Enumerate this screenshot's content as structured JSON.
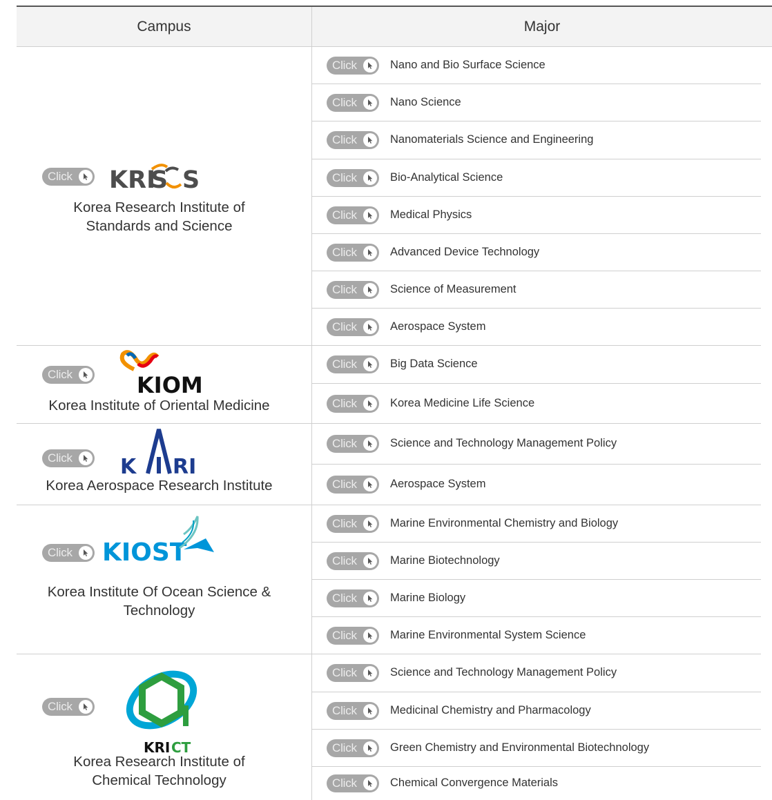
{
  "header": {
    "campus": "Campus",
    "major": "Major"
  },
  "click_label": "Click",
  "colors": {
    "button": "#a7a7a7",
    "kriss": "#4d4d4d",
    "kriss_accent": "#f29100",
    "kiom_blue": "#0068b7",
    "kari_blue": "#1d3c8f",
    "kiost_blue": "#0095d9",
    "krict_green": "#2e9e3f"
  },
  "campuses": [
    {
      "name_line1": "Korea Research Institute of",
      "name_line2": "Standards and Science",
      "logo_text": "KRISS"
    },
    {
      "name_line1": "Korea Institute of Oriental Medicine",
      "logo_text": "KIOM"
    },
    {
      "name_line1": "Korea Aerospace Research Institute",
      "logo_text": "KARI"
    },
    {
      "name_line1": "Korea Institute Of Ocean Science &",
      "name_line2": "Technology",
      "logo_text": "KIOST"
    },
    {
      "name_line1": "Korea Research Institute of",
      "name_line2": "Chemical Technology",
      "logo_text": "KRICT"
    }
  ],
  "majors": [
    "Nano and Bio Surface Science",
    "Nano Science",
    "Nanomaterials Science and Engineering",
    "Bio-Analytical Science",
    "Medical Physics",
    "Advanced Device Technology",
    "Science of Measurement",
    "Aerospace System",
    "Big Data Science",
    "Korea Medicine Life Science",
    "Science and Technology Management Policy",
    "Aerospace System",
    "Marine Environmental Chemistry and Biology",
    "Marine Biotechnology",
    "Marine Biology",
    "Marine Environmental System Science",
    "Science and Technology Management Policy",
    "Medicinal Chemistry and Pharmacology",
    "Green Chemistry and Environmental Biotechnology",
    "Chemical Convergence Materials"
  ]
}
